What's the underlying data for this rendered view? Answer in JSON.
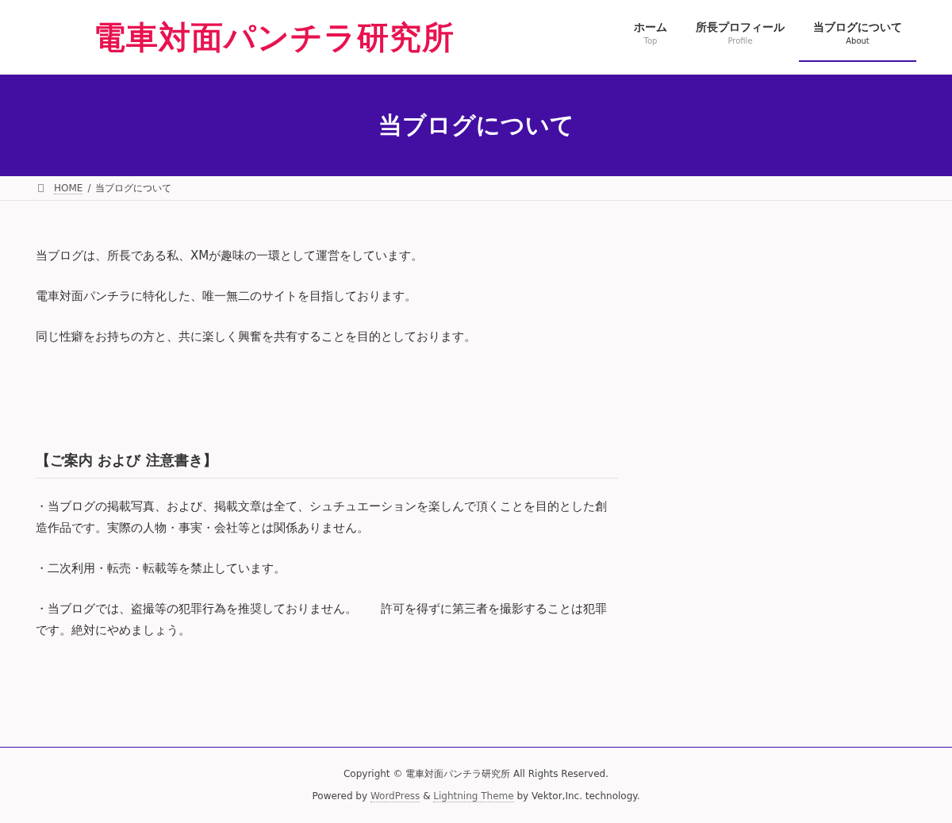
{
  "header": {
    "logo": "電車対面パンチラ研究所",
    "nav": [
      {
        "label": "ホーム",
        "sub": "Top",
        "selected": false
      },
      {
        "label": "所長プロフィール",
        "sub": "Profile",
        "selected": false
      },
      {
        "label": "当ブログについて",
        "sub": "About",
        "selected": true
      }
    ]
  },
  "hero": {
    "title": "当ブログについて"
  },
  "breadcrumb": [
    {
      "label": "HOME",
      "kind": "link"
    },
    {
      "label": "/",
      "kind": "separator"
    },
    {
      "label": "当ブログについて",
      "kind": "current"
    }
  ],
  "intro": [
    "当ブログは、所長である私、XMが趣味の一環として運営をしています。",
    "電車対面パンチラに特化した、唯一無二のサイトを目指しております。",
    "同じ性癖をお持ちの方と、共に楽しく興奮を共有することを目的としております。"
  ],
  "notice": {
    "heading": "【ご案内 および 注意書き】",
    "paragraphs": [
      "・当ブログの掲載写真、および、掲載文章は全て、シュチュエーションを楽しんで頂くことを目的とした創造作品です。実際の人物・事実・会社等とは関係ありません。",
      "・二次利用・転売・転載等を禁止しています。",
      "・当ブログでは、盗撮等の犯罪行為を推奨しておりません。　　許可を得ずに第三者を撮影することは犯罪です。絶対にやめましょう。"
    ]
  },
  "footer": {
    "copyright": "Copyright © 電車対面パンチラ研究所 All Rights Reserved.",
    "powered": [
      {
        "kind": "text",
        "text": "Powered by "
      },
      {
        "kind": "link",
        "text": "WordPress"
      },
      {
        "kind": "text",
        "text": " & "
      },
      {
        "kind": "link",
        "text": "Lightning Theme"
      },
      {
        "kind": "text",
        "text": " by Vektor,Inc. technology."
      }
    ]
  }
}
